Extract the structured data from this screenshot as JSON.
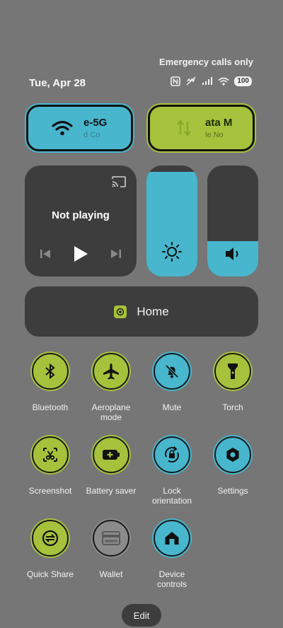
{
  "status": {
    "carrier_text": "Emergency calls only",
    "date": "Tue, Apr 28",
    "battery": "100"
  },
  "tiles": {
    "wifi": {
      "title": "e-5G",
      "subtitle": "d   Co",
      "icon": "wifi-icon",
      "color": "#48b6cd"
    },
    "data": {
      "title": "ata    M",
      "subtitle": "le   No",
      "icon": "mobile-data-icon",
      "color": "#a6c23c"
    }
  },
  "media": {
    "status": "Not playing"
  },
  "sliders": {
    "brightness": {
      "level": 0.94,
      "icon": "brightness-icon"
    },
    "volume": {
      "level": 0.32,
      "icon": "volume-icon"
    }
  },
  "home": {
    "label": "Home"
  },
  "quick_settings": [
    {
      "label": "Bluetooth",
      "icon": "bluetooth-icon",
      "state": "on"
    },
    {
      "label": "Aeroplane\nmode",
      "icon": "aeroplane-icon",
      "state": "on"
    },
    {
      "label": "Mute",
      "icon": "bell-off-icon",
      "state": "accent"
    },
    {
      "label": "Torch",
      "icon": "torch-icon",
      "state": "on"
    },
    {
      "label": "Screenshot",
      "icon": "screenshot-icon",
      "state": "on"
    },
    {
      "label": "Battery saver",
      "icon": "battery-saver-icon",
      "state": "on"
    },
    {
      "label": "Lock\norientation",
      "icon": "lock-rotation-icon",
      "state": "accent"
    },
    {
      "label": "Settings",
      "icon": "settings-icon",
      "state": "accent"
    },
    {
      "label": "Quick Share",
      "icon": "quick-share-icon",
      "state": "on"
    },
    {
      "label": "Wallet",
      "icon": "wallet-icon",
      "state": "off"
    },
    {
      "label": "Device\ncontrols",
      "icon": "home-controls-icon",
      "state": "accent"
    }
  ],
  "edit": {
    "label": "Edit"
  },
  "colors": {
    "accent_green": "#a6c23c",
    "accent_blue": "#48b6cd",
    "background": "#767676",
    "panel": "#3d3d3d"
  }
}
